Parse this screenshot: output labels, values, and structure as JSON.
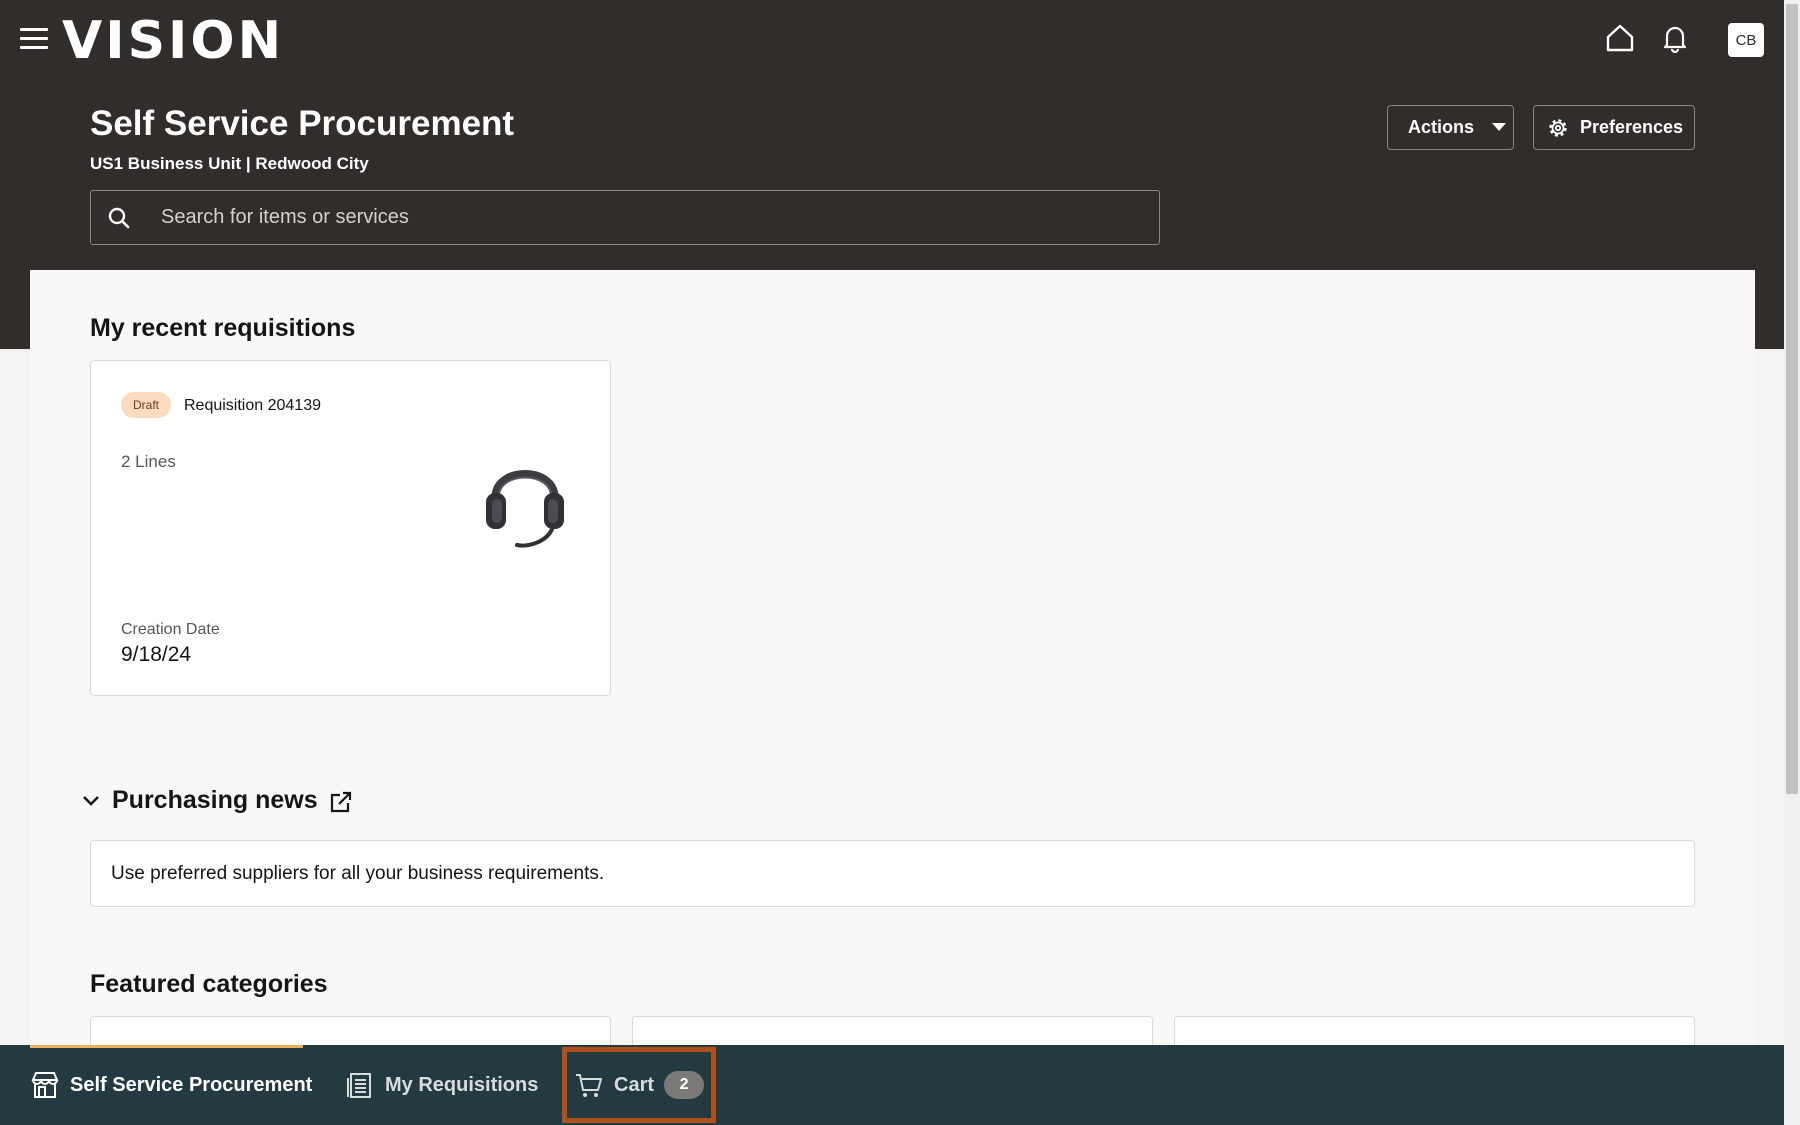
{
  "header": {
    "logo": "VISION",
    "avatar_initials": "CB",
    "icons": [
      "menu-icon",
      "home-icon",
      "bell-icon"
    ]
  },
  "page": {
    "title": "Self Service Procurement",
    "subtitle": "US1 Business Unit | Redwood City",
    "actions_label": "Actions",
    "preferences_label": "Preferences"
  },
  "search": {
    "placeholder": "Search for items or services",
    "value": ""
  },
  "recent": {
    "heading": "My recent requisitions",
    "card": {
      "status": "Draft",
      "title": "Requisition 204139",
      "lines": "2 Lines",
      "date_label": "Creation Date",
      "date": "9/18/24",
      "image": "headset"
    }
  },
  "news": {
    "heading": "Purchasing news",
    "message": "Use preferred suppliers for all your business requirements."
  },
  "featured": {
    "heading": "Featured categories"
  },
  "bottom_nav": {
    "items": [
      {
        "label": "Self Service Procurement",
        "icon": "store-icon",
        "active": true
      },
      {
        "label": "My Requisitions",
        "icon": "requisitions-icon",
        "active": false
      },
      {
        "label": "Cart",
        "icon": "cart-icon",
        "active": false,
        "count": "2"
      }
    ]
  },
  "colors": {
    "header_bg": "#312d2a",
    "bottom_nav_bg": "#223a40",
    "active_indicator": "#e8b35b",
    "cart_highlight": "#b0501d",
    "draft_badge_bg": "#fcdcc0"
  }
}
